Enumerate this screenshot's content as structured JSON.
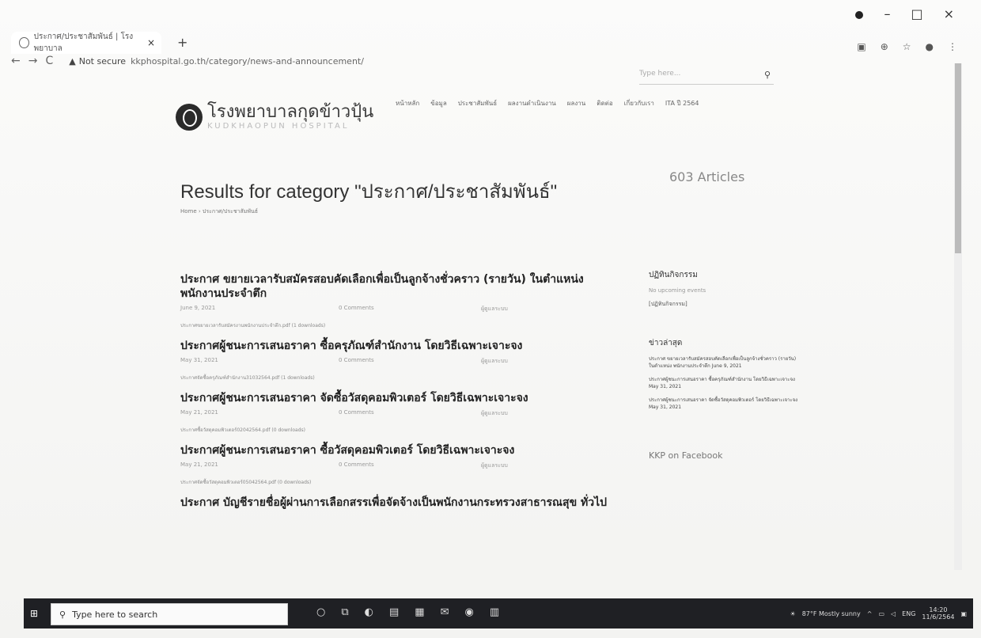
{
  "browser": {
    "tab_title": "ประกาศ/ประชาสัมพันธ์ | โรงพยาบาล",
    "tab_close": "×",
    "new_tab": "+",
    "address_warning": "Not secure",
    "address_url": "kkphospital.go.th/category/news-and-announcement/"
  },
  "site": {
    "search_placeholder": "Type here...",
    "logo_th": "โรงพยาบาลกุดข้าวปุ้น",
    "logo_en": "KUDKHAOPUN HOSPITAL",
    "menu": [
      "หน้าหลัก",
      "ข้อมูล",
      "ประชาสัมพันธ์",
      "ผลงานดำเนินงาน",
      "ผลงาน",
      "ติดต่อ",
      "เกี่ยวกับเรา",
      "ITA ปี 2564"
    ]
  },
  "page": {
    "results_title": "Results for category \"ประกาศ/ประชาสัมพันธ์\"",
    "articles_count": "603 Articles",
    "breadcrumb": "Home  ›  ประกาศ/ประชาสัมพันธ์"
  },
  "articles": [
    {
      "title": "ประกาศ ขยายเวลารับสมัครสอบคัดเลือกเพื่อเป็นลูกจ้างชั่วคราว (รายวัน) ในตำแหน่ง พนักงานประจำตึก",
      "date": "June 9, 2021",
      "comments": "0 Comments",
      "author": "ผู้ดูแลระบบ",
      "attachment": "ประกาศขยายเวลารับสมัครงานพนักงานประจำตึก.pdf (1 downloads)"
    },
    {
      "title": "ประกาศผู้ชนะการเสนอราคา ซื้อครุภัณฑ์สำนักงาน โดยวิธีเฉพาะเจาะจง",
      "date": "May 31, 2021",
      "comments": "0 Comments",
      "author": "ผู้ดูแลระบบ",
      "attachment": "ประกาศจัดซื้อครุภัณฑ์สำนักงาน31032564.pdf (1 downloads)"
    },
    {
      "title": "ประกาศผู้ชนะการเสนอราคา จัดซื้อวัสดุคอมพิวเตอร์ โดยวิธีเฉพาะเจาะจง",
      "date": "May 21, 2021",
      "comments": "0 Comments",
      "author": "ผู้ดูแลระบบ",
      "attachment": "ประกาศซื้อวัสดุคอมพิวเตอร์02042564.pdf (0 downloads)"
    },
    {
      "title": "ประกาศผู้ชนะการเสนอราคา ซื้อวัสดุคอมพิวเตอร์ โดยวิธีเฉพาะเจาะจง",
      "date": "May 21, 2021",
      "comments": "0 Comments",
      "author": "ผู้ดูแลระบบ",
      "attachment": "ประกาศจัดซื้อวัสดุคอมพิวเตอร์05042564.pdf (0 downloads)"
    },
    {
      "title": "ประกาศ บัญชีรายชื่อผู้ผ่านการเลือกสรรเพื่อจัดจ้างเป็นพนักงานกระทรวงสาธารณสุข ทั่วไป",
      "date": "",
      "comments": "",
      "author": "",
      "attachment": ""
    }
  ],
  "sidebar": {
    "events_heading": "ปฏิทินกิจกรรม",
    "no_events": "No upcoming events",
    "events_link": "[ปฏิทินกิจกรรม]",
    "news_heading": "ข่าวล่าสุด",
    "news": [
      "ประกาศ ขยายเวลารับสมัครสอบคัดเลือกเพื่อเป็นลูกจ้างชั่วคราว (รายวัน) ในตำแหน่ง พนักงานประจำตึก June 9, 2021",
      "ประกาศผู้ชนะการเสนอราคา ซื้อครุภัณฑ์สำนักงาน โดยวิธีเฉพาะเจาะจง May 31, 2021",
      "ประกาศผู้ชนะการเสนอราคา จัดซื้อวัสดุคอมพิวเตอร์ โดยวิธีเฉพาะเจาะจง May 31, 2021"
    ],
    "facebook_heading": "KKP on Facebook"
  },
  "taskbar": {
    "search_placeholder": "Type here to search",
    "weather": "87°F  Mostly sunny",
    "lang": "ENG",
    "time": "14:20",
    "date": "11/6/2564"
  }
}
